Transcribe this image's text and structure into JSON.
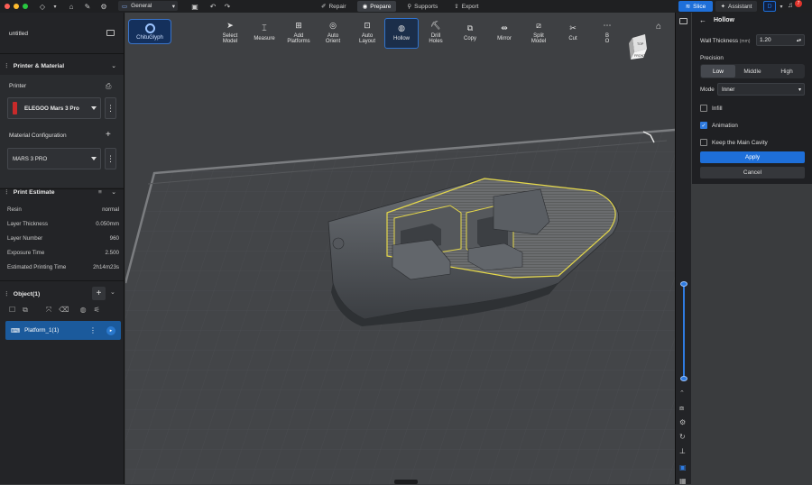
{
  "topbar": {
    "workspace": "General",
    "modes": [
      {
        "label": "Repair",
        "icon": "wrench-icon"
      },
      {
        "label": "Prepare",
        "icon": "prepare-icon"
      },
      {
        "label": "Supports",
        "icon": "support-icon"
      },
      {
        "label": "Export",
        "icon": "export-icon"
      }
    ],
    "active_mode": "Prepare",
    "slice_label": "Slice",
    "assistant_label": "Assistant",
    "avatar_letter": "D",
    "notification_count": "7",
    "accent": "#1e6fd9"
  },
  "left": {
    "file_title": "untitled",
    "printer_material": {
      "heading": "Printer & Material",
      "printer_label": "Printer",
      "printer_value": "ELEGOO Mars 3 Pro",
      "material_label": "Material Configuration",
      "material_value": "MARS 3 PRO"
    },
    "print_estimate": {
      "heading": "Print Estimate",
      "rows": [
        {
          "key": "Resin",
          "value": "normal"
        },
        {
          "key": "Layer Thickness",
          "value": "0.050mm"
        },
        {
          "key": "Layer Number",
          "value": "960"
        },
        {
          "key": "Exposure Time",
          "value": "2.500"
        },
        {
          "key": "Estimated Printing Time",
          "value": "2h14m23s"
        }
      ]
    },
    "objects": {
      "heading": "Object(1)",
      "item": "Platform_1(1)"
    }
  },
  "toolbar": {
    "brand": "ChituGlyph",
    "tools": [
      {
        "label": "Select\nModel",
        "icon": "cursor-icon"
      },
      {
        "label": "Measure",
        "icon": "measure-icon"
      },
      {
        "label": "Add\nPlatforms",
        "icon": "add-platform-icon"
      },
      {
        "label": "Auto\nOrient",
        "icon": "orient-icon"
      },
      {
        "label": "Auto\nLayout",
        "icon": "layout-icon"
      },
      {
        "label": "Hollow",
        "icon": "hollow-icon"
      },
      {
        "label": "Drill\nHoles",
        "icon": "drill-icon"
      },
      {
        "label": "Copy",
        "icon": "copy-icon"
      },
      {
        "label": "Mirror",
        "icon": "mirror-icon"
      },
      {
        "label": "Split\nModel",
        "icon": "split-icon"
      },
      {
        "label": "Cut",
        "icon": "cut-icon"
      },
      {
        "label": "B\nO",
        "icon": "more-icon"
      }
    ],
    "active_tool": "Hollow",
    "view_cube_top": "TOP",
    "view_cube_front": "FRONT"
  },
  "hollow_panel": {
    "title": "Hollow",
    "wall_thickness_label": "Wall Thickness",
    "wall_thickness_unit": "(mm)",
    "wall_thickness_value": "1.20",
    "precision_label": "Precision",
    "precision_options": [
      "Low",
      "Middle",
      "High"
    ],
    "precision_selected": "Low",
    "mode_label": "Mode",
    "mode_value": "Inner",
    "infill_label": "Infill",
    "infill_checked": false,
    "animation_label": "Animation",
    "animation_checked": true,
    "keep_cavity_label": "Keep the Main Cavity",
    "keep_cavity_checked": false,
    "apply_label": "Apply",
    "cancel_label": "Cancel"
  },
  "layer_slider": {
    "low": 0,
    "high": 1
  }
}
